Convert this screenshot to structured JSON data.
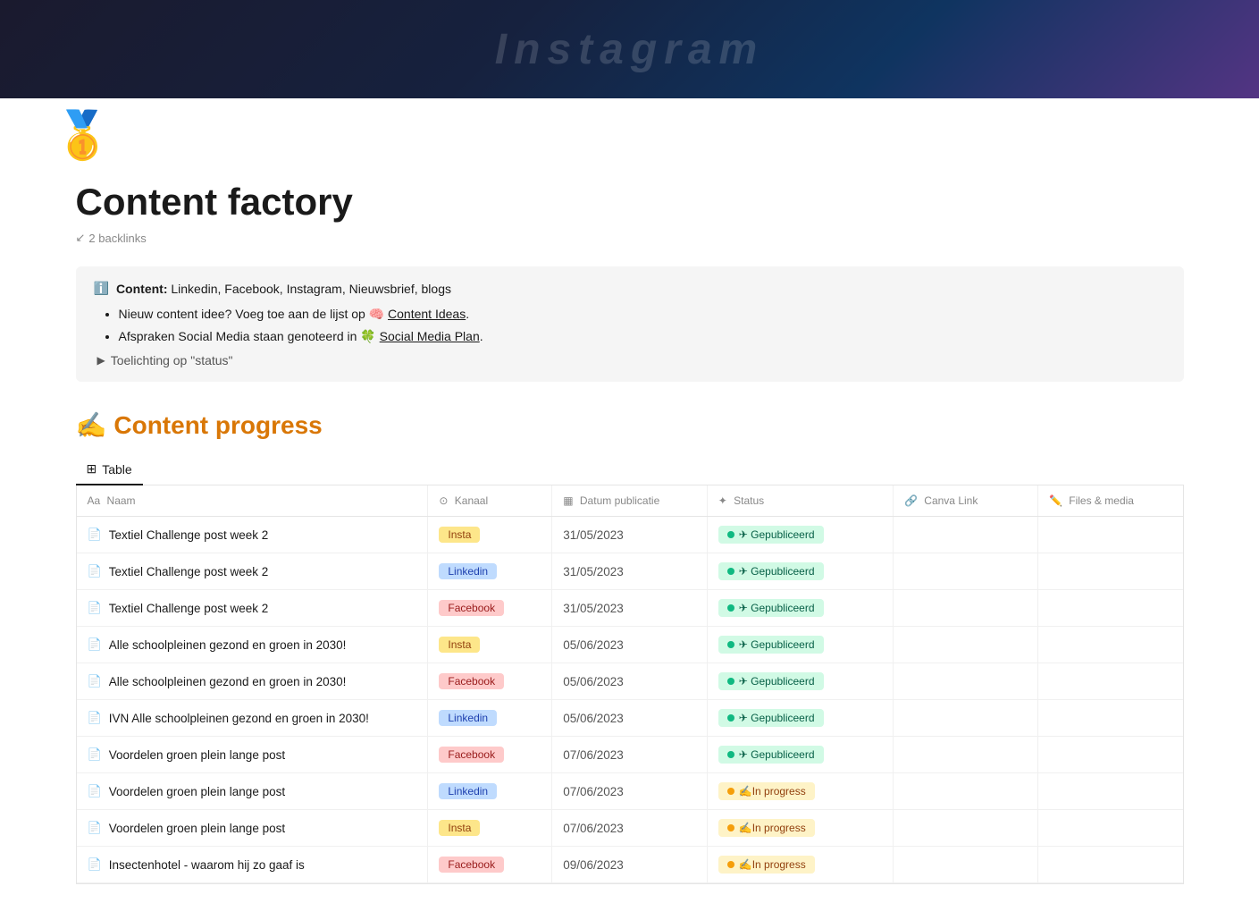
{
  "hero": {
    "text": "Instagram"
  },
  "medal": "🥇",
  "page": {
    "title": "Content factory",
    "backlinks_label": "2 backlinks"
  },
  "infobox": {
    "icon": "ℹ️",
    "label": "Content:",
    "platforms": "Linkedin, Facebook, Instagram, Nieuwsbrief, blogs",
    "bullet1_prefix": "Nieuw content idee? Voeg toe aan de lijst op",
    "bullet1_emoji": "🧠",
    "bullet1_link": "Content Ideas",
    "bullet1_suffix": ".",
    "bullet2_prefix": "Afspraken Social Media staan genoteerd in",
    "bullet2_emoji": "🍀",
    "bullet2_link": "Social Media Plan",
    "bullet2_suffix": ".",
    "toelichting": "Toelichting op \"status\""
  },
  "section": {
    "emoji": "✍️",
    "title": "Content progress"
  },
  "tabs": [
    {
      "label": "Table",
      "active": true
    }
  ],
  "table": {
    "headers": [
      {
        "icon": "Aa",
        "label": "Naam"
      },
      {
        "icon": "⊙",
        "label": "Kanaal"
      },
      {
        "icon": "▦",
        "label": "Datum publicatie"
      },
      {
        "icon": "✦",
        "label": "Status"
      },
      {
        "icon": "🔗",
        "label": "Canva Link"
      },
      {
        "icon": "✏️",
        "label": "Files & media"
      }
    ],
    "rows": [
      {
        "naam": "Textiel Challenge post week 2",
        "kanaal": "Insta",
        "kanaal_type": "insta",
        "datum": "31/05/2023",
        "status": "Gepubliceerd",
        "status_type": "gepubliceerd",
        "canva": "",
        "files": ""
      },
      {
        "naam": "Textiel Challenge post week 2",
        "kanaal": "Linkedin",
        "kanaal_type": "linkedin",
        "datum": "31/05/2023",
        "status": "Gepubliceerd",
        "status_type": "gepubliceerd",
        "canva": "",
        "files": ""
      },
      {
        "naam": "Textiel Challenge post week 2",
        "kanaal": "Facebook",
        "kanaal_type": "facebook",
        "datum": "31/05/2023",
        "status": "Gepubliceerd",
        "status_type": "gepubliceerd",
        "canva": "",
        "files": ""
      },
      {
        "naam": "Alle schoolpleinen gezond en groen in 2030!",
        "kanaal": "Insta",
        "kanaal_type": "insta",
        "datum": "05/06/2023",
        "status": "Gepubliceerd",
        "status_type": "gepubliceerd",
        "canva": "",
        "files": ""
      },
      {
        "naam": "Alle schoolpleinen gezond en groen in 2030!",
        "kanaal": "Facebook",
        "kanaal_type": "facebook",
        "datum": "05/06/2023",
        "status": "Gepubliceerd",
        "status_type": "gepubliceerd",
        "canva": "",
        "files": ""
      },
      {
        "naam": "IVN Alle schoolpleinen gezond en groen in 2030!",
        "kanaal": "Linkedin",
        "kanaal_type": "linkedin",
        "datum": "05/06/2023",
        "status": "Gepubliceerd",
        "status_type": "gepubliceerd",
        "canva": "",
        "files": ""
      },
      {
        "naam": "Voordelen groen plein lange post",
        "kanaal": "Facebook",
        "kanaal_type": "facebook",
        "datum": "07/06/2023",
        "status": "Gepubliceerd",
        "status_type": "gepubliceerd",
        "canva": "",
        "files": ""
      },
      {
        "naam": "Voordelen groen plein lange post",
        "kanaal": "Linkedin",
        "kanaal_type": "linkedin",
        "datum": "07/06/2023",
        "status": "✍️In progress",
        "status_type": "inprogress",
        "canva": "",
        "files": ""
      },
      {
        "naam": "Voordelen groen plein lange post",
        "kanaal": "Insta",
        "kanaal_type": "insta",
        "datum": "07/06/2023",
        "status": "✍️In progress",
        "status_type": "inprogress",
        "canva": "",
        "files": ""
      },
      {
        "naam": "Insectenhotel - waarom hij zo gaaf is",
        "kanaal": "Facebook",
        "kanaal_type": "facebook",
        "datum": "09/06/2023",
        "status": "✍️In progress",
        "status_type": "inprogress",
        "canva": "",
        "files": ""
      }
    ]
  }
}
